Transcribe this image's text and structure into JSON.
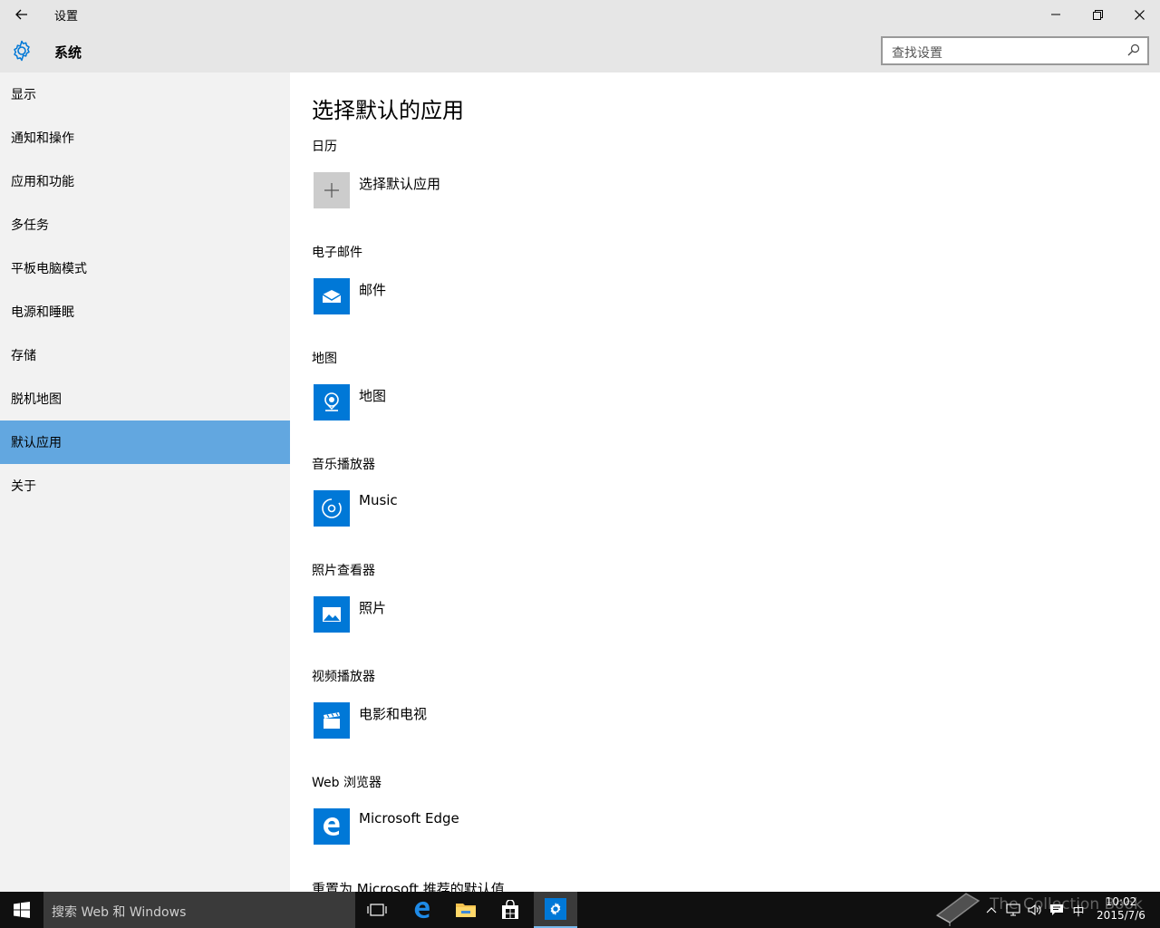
{
  "window": {
    "title": "设置",
    "back_icon": "back-arrow-icon",
    "minimize_icon": "minimize-icon",
    "restore_icon": "restore-icon",
    "close_icon": "close-icon"
  },
  "header": {
    "section_title": "系统",
    "icon": "gear-icon",
    "search_placeholder": "查找设置"
  },
  "sidebar": {
    "active_index": 8,
    "accent_color": "#62a7e0",
    "items": [
      {
        "label": "显示"
      },
      {
        "label": "通知和操作"
      },
      {
        "label": "应用和功能"
      },
      {
        "label": "多任务"
      },
      {
        "label": "平板电脑模式"
      },
      {
        "label": "电源和睡眠"
      },
      {
        "label": "存储"
      },
      {
        "label": "脱机地图"
      },
      {
        "label": "默认应用"
      },
      {
        "label": "关于"
      }
    ]
  },
  "main": {
    "title": "选择默认的应用",
    "tile_color": "#0078d7",
    "categories": [
      {
        "label": "日历",
        "app": "选择默认应用",
        "icon": "plus-icon"
      },
      {
        "label": "电子邮件",
        "app": "邮件",
        "icon": "mail-icon"
      },
      {
        "label": "地图",
        "app": "地图",
        "icon": "maps-icon"
      },
      {
        "label": "音乐播放器",
        "app": "Music",
        "icon": "music-icon"
      },
      {
        "label": "照片查看器",
        "app": "照片",
        "icon": "photos-icon"
      },
      {
        "label": "视频播放器",
        "app": "电影和电视",
        "icon": "movies-tv-icon"
      },
      {
        "label": "Web 浏览器",
        "app": "Microsoft Edge",
        "icon": "edge-icon"
      }
    ],
    "reset_label": "重置为 Microsoft 推荐的默认值"
  },
  "taskbar": {
    "search_placeholder": "搜索 Web 和 Windows",
    "ime_label": "中",
    "clock_time": "10:02",
    "clock_date": "2015/7/6",
    "watermark": "The Collection Book",
    "icons": [
      "task-view-icon",
      "edge-icon",
      "file-explorer-icon",
      "store-icon",
      "settings-icon"
    ]
  }
}
